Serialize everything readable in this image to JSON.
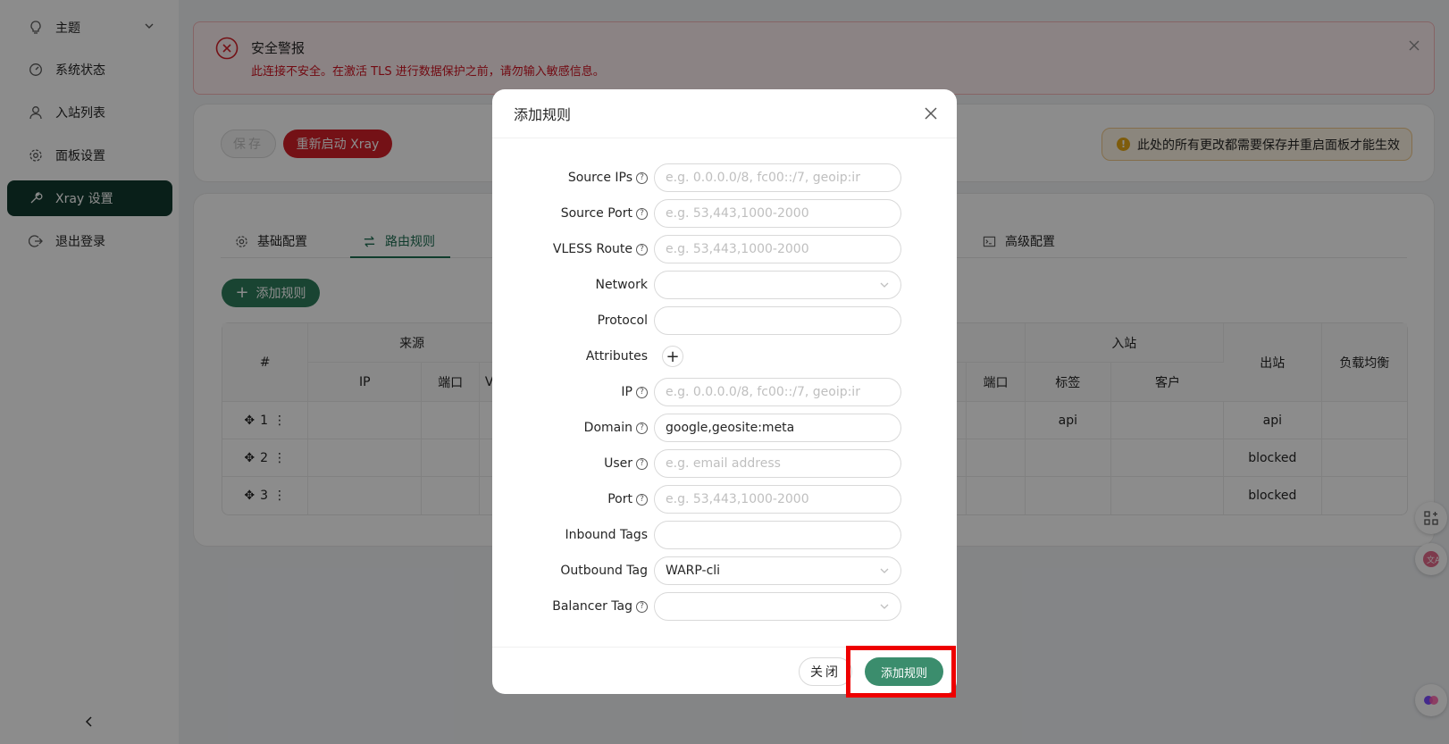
{
  "colors": {
    "accent": "#1e6e52",
    "danger": "#d32029",
    "sidebar_active": "#12392e",
    "highlight": "#ee0000"
  },
  "sidebar": {
    "items": [
      {
        "label": "主题",
        "icon": "bulb-icon"
      },
      {
        "label": "系统状态",
        "icon": "dashboard-icon"
      },
      {
        "label": "入站列表",
        "icon": "user-icon"
      },
      {
        "label": "面板设置",
        "icon": "gear-icon"
      },
      {
        "label": "Xray 设置",
        "icon": "tool-icon"
      },
      {
        "label": "退出登录",
        "icon": "logout-icon"
      }
    ],
    "active_index": 4
  },
  "alert": {
    "title": "安全警报",
    "description": "此连接不安全。在激活 TLS 进行数据保护之前，请勿输入敏感信息。"
  },
  "toolbar": {
    "save_label": "保存",
    "restart_label": "重新启动 Xray",
    "warning": "此处的所有更改都需要保存并重启面板才能生效"
  },
  "tabs": [
    {
      "label": "基础配置",
      "icon": "gear-icon"
    },
    {
      "label": "路由规则",
      "icon": "swap-icon"
    },
    {
      "label": "高级配置",
      "icon": "code-icon"
    }
  ],
  "active_tab": 1,
  "add_rule_label": "添加规则",
  "table": {
    "group_headers": {
      "source": "来源",
      "inbound": "入站"
    },
    "headers": {
      "index": "#",
      "ip": "IP",
      "port": "端口",
      "vless": "VL",
      "in_port": "端口",
      "tag": "标签",
      "client": "客户",
      "outbound": "出站",
      "balancer": "负载均衡"
    },
    "rows": [
      {
        "index": "1",
        "tag": "api",
        "outbound": "api"
      },
      {
        "index": "2",
        "tag": "",
        "outbound": "blocked"
      },
      {
        "index": "3",
        "tag": "",
        "outbound": "blocked"
      }
    ]
  },
  "modal": {
    "title": "添加规则",
    "fields": [
      {
        "label": "Source IPs",
        "help": true,
        "value": "",
        "placeholder": "e.g. 0.0.0.0/8, fc00::/7, geoip:ir",
        "type": "input"
      },
      {
        "label": "Source Port",
        "help": true,
        "value": "",
        "placeholder": "e.g. 53,443,1000-2000",
        "type": "input"
      },
      {
        "label": "VLESS Route",
        "help": true,
        "value": "",
        "placeholder": "e.g. 53,443,1000-2000",
        "type": "input"
      },
      {
        "label": "Network",
        "help": false,
        "value": "",
        "placeholder": "",
        "type": "select"
      },
      {
        "label": "Protocol",
        "help": false,
        "value": "",
        "placeholder": "",
        "type": "input"
      },
      {
        "label": "Attributes",
        "help": false,
        "value": "",
        "placeholder": "",
        "type": "add"
      },
      {
        "label": "IP",
        "help": true,
        "value": "",
        "placeholder": "e.g. 0.0.0.0/8, fc00::/7, geoip:ir",
        "type": "input"
      },
      {
        "label": "Domain",
        "help": true,
        "value": "google,geosite:meta",
        "placeholder": "",
        "type": "input"
      },
      {
        "label": "User",
        "help": true,
        "value": "",
        "placeholder": "e.g. email address",
        "type": "input"
      },
      {
        "label": "Port",
        "help": true,
        "value": "",
        "placeholder": "e.g. 53,443,1000-2000",
        "type": "input"
      },
      {
        "label": "Inbound Tags",
        "help": false,
        "value": "",
        "placeholder": "",
        "type": "input"
      },
      {
        "label": "Outbound Tag",
        "help": false,
        "value": "WARP-cli",
        "placeholder": "",
        "type": "select"
      },
      {
        "label": "Balancer Tag",
        "help": true,
        "value": "",
        "placeholder": "",
        "type": "select"
      }
    ],
    "close_label": "关闭",
    "submit_label": "添加规则"
  },
  "help_glyph": "?"
}
